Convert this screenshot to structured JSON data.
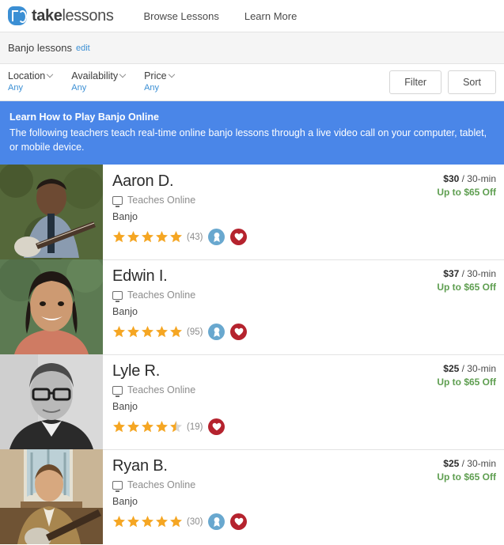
{
  "header": {
    "logo": {
      "icon": "takelessons-logo-icon",
      "bold_part": "take",
      "light_part": "lessons"
    },
    "nav": [
      {
        "label": "Browse Lessons",
        "name": "nav-browse-lessons"
      },
      {
        "label": "Learn More",
        "name": "nav-learn-more"
      }
    ]
  },
  "subject_bar": {
    "title": "Banjo lessons",
    "edit_label": "edit"
  },
  "filters": [
    {
      "label": "Location",
      "value": "Any",
      "name": "filter-location"
    },
    {
      "label": "Availability",
      "value": "Any",
      "name": "filter-availability"
    },
    {
      "label": "Price",
      "value": "Any",
      "name": "filter-price"
    }
  ],
  "filter_actions": {
    "filter_label": "Filter",
    "sort_label": "Sort"
  },
  "banner": {
    "title": "Learn How to Play Banjo Online",
    "text": "The following teachers teach real-time online banjo lessons through a live video call on your computer, tablet, or mobile device.",
    "background_color": "#4a86e8"
  },
  "colors": {
    "star": "#f5a623",
    "star_empty": "#d8d8d8",
    "link": "#3b8fd4",
    "discount": "#5e9e50",
    "badge_blue": "#69a8cf",
    "badge_red": "#b5232e"
  },
  "listings": [
    {
      "name": "Aaron D.",
      "online_label": "Teaches Online",
      "instrument": "Banjo",
      "rating": 5,
      "review_count": "(43)",
      "price": "$30",
      "price_unit": "/ 30-min",
      "discount": "Up to $65 Off",
      "badges": [
        "award-badge-icon",
        "heart-badge-icon"
      ],
      "photo": "teacher-photo-aaron"
    },
    {
      "name": "Edwin I.",
      "online_label": "Teaches Online",
      "instrument": "Banjo",
      "rating": 5,
      "review_count": "(95)",
      "price": "$37",
      "price_unit": "/ 30-min",
      "discount": "Up to $65 Off",
      "badges": [
        "award-badge-icon",
        "heart-badge-icon"
      ],
      "photo": "teacher-photo-edwin"
    },
    {
      "name": "Lyle R.",
      "online_label": "Teaches Online",
      "instrument": "Banjo",
      "rating": 4.5,
      "review_count": "(19)",
      "price": "$25",
      "price_unit": "/ 30-min",
      "discount": "Up to $65 Off",
      "badges": [
        "heart-badge-icon"
      ],
      "photo": "teacher-photo-lyle"
    },
    {
      "name": "Ryan B.",
      "online_label": "Teaches Online",
      "instrument": "Banjo",
      "rating": 5,
      "review_count": "(30)",
      "price": "$25",
      "price_unit": "/ 30-min",
      "discount": "Up to $65 Off",
      "badges": [
        "award-badge-icon",
        "heart-badge-icon"
      ],
      "photo": "teacher-photo-ryan"
    }
  ]
}
